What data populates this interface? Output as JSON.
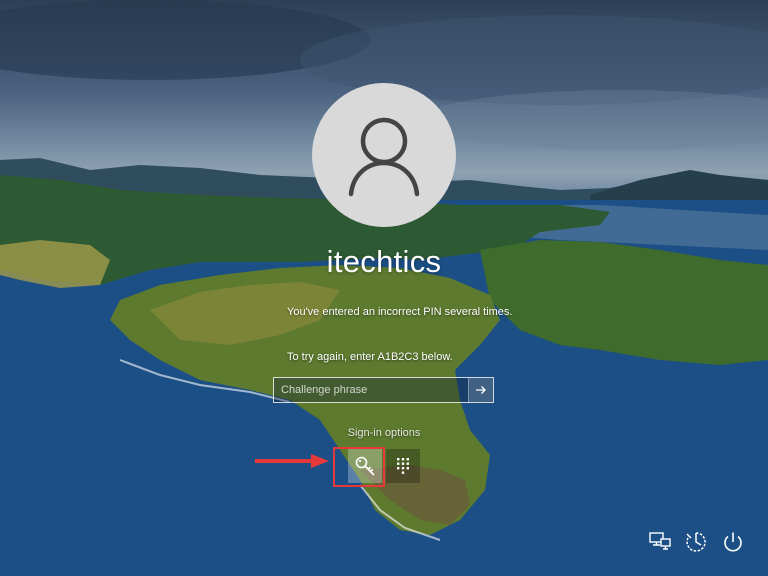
{
  "user": {
    "name": "itechtics",
    "avatar_icon": "user-silhouette-icon"
  },
  "message": {
    "line1": "You've entered an incorrect PIN several times.",
    "line2": "To try again, enter A1B2C3 below."
  },
  "challenge": {
    "placeholder": "Challenge phrase",
    "value": "",
    "submit_icon": "arrow-right-icon"
  },
  "signin_options": {
    "label": "Sign-in options",
    "options": [
      {
        "icon": "key-icon",
        "selected": true
      },
      {
        "icon": "pin-keypad-icon",
        "selected": false
      }
    ]
  },
  "annotation": {
    "highlight_color": "#e63a3a"
  },
  "corner_buttons": [
    {
      "icon": "network-icon"
    },
    {
      "icon": "ease-of-access-icon"
    },
    {
      "icon": "power-icon"
    }
  ]
}
